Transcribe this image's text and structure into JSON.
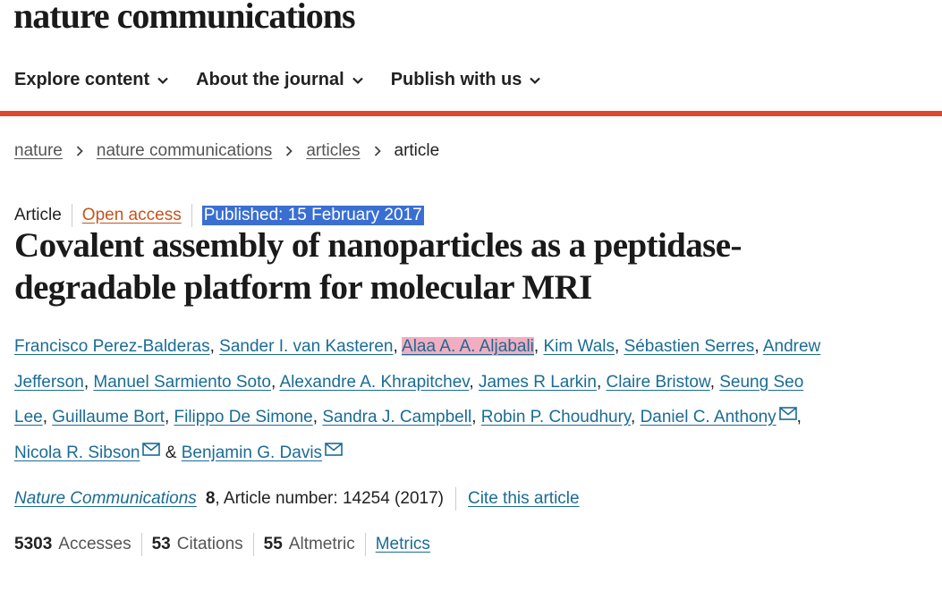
{
  "brand": "nature communications",
  "nav": [
    {
      "label": "Explore content"
    },
    {
      "label": "About the journal"
    },
    {
      "label": "Publish with us"
    }
  ],
  "breadcrumb": [
    {
      "label": "nature"
    },
    {
      "label": "nature communications"
    },
    {
      "label": "articles"
    },
    {
      "label": "article"
    }
  ],
  "meta": {
    "type": "Article",
    "access": "Open access",
    "published": "Published: 15 February 2017"
  },
  "title": "Covalent assembly of nanoparticles as a peptidase-degradable platform for molecular MRI",
  "authors": [
    {
      "name": "Francisco Perez-Balderas"
    },
    {
      "name": "Sander I. van Kasteren"
    },
    {
      "name": "Alaa A. A. Aljabali"
    },
    {
      "name": "Kim Wals"
    },
    {
      "name": "Sébastien Serres"
    },
    {
      "name": "Andrew Jefferson"
    },
    {
      "name": "Manuel Sarmiento Soto"
    },
    {
      "name": "Alexandre A. Khrapitchev"
    },
    {
      "name": "James R Larkin"
    },
    {
      "name": "Claire Bristow"
    },
    {
      "name": "Seung Seo Lee"
    },
    {
      "name": "Guillaume Bort"
    },
    {
      "name": "Filippo De Simone"
    },
    {
      "name": "Sandra J. Campbell"
    },
    {
      "name": "Robin P. Choudhury"
    },
    {
      "name": "Daniel C. Anthony"
    },
    {
      "name": "Nicola R. Sibson"
    },
    {
      "name": "Benjamin G. Davis"
    }
  ],
  "authors_joiner": "&",
  "citation": {
    "journal": "Nature Communications",
    "volume": "8",
    "article_number": ", Article number: 14254 (2017)",
    "cite_link": "Cite this article"
  },
  "metrics": {
    "accesses_value": "5303",
    "accesses_label": "Accesses",
    "citations_value": "53",
    "citations_label": "Citations",
    "altmetric_value": "55",
    "altmetric_label": "Altmetric",
    "metrics_link": "Metrics"
  },
  "colors": {
    "accent_red": "#e0452e",
    "link_blue": "#1a6c94",
    "highlight_blue": "#3a6fd1",
    "highlight_pink": "#e9698c",
    "open_access_orange": "#c4541c"
  },
  "icons": {
    "nav_dropdown": "chevron-down-icon",
    "breadcrumb_separator": "chevron-right-icon",
    "corresponding_author": "mail-icon"
  }
}
